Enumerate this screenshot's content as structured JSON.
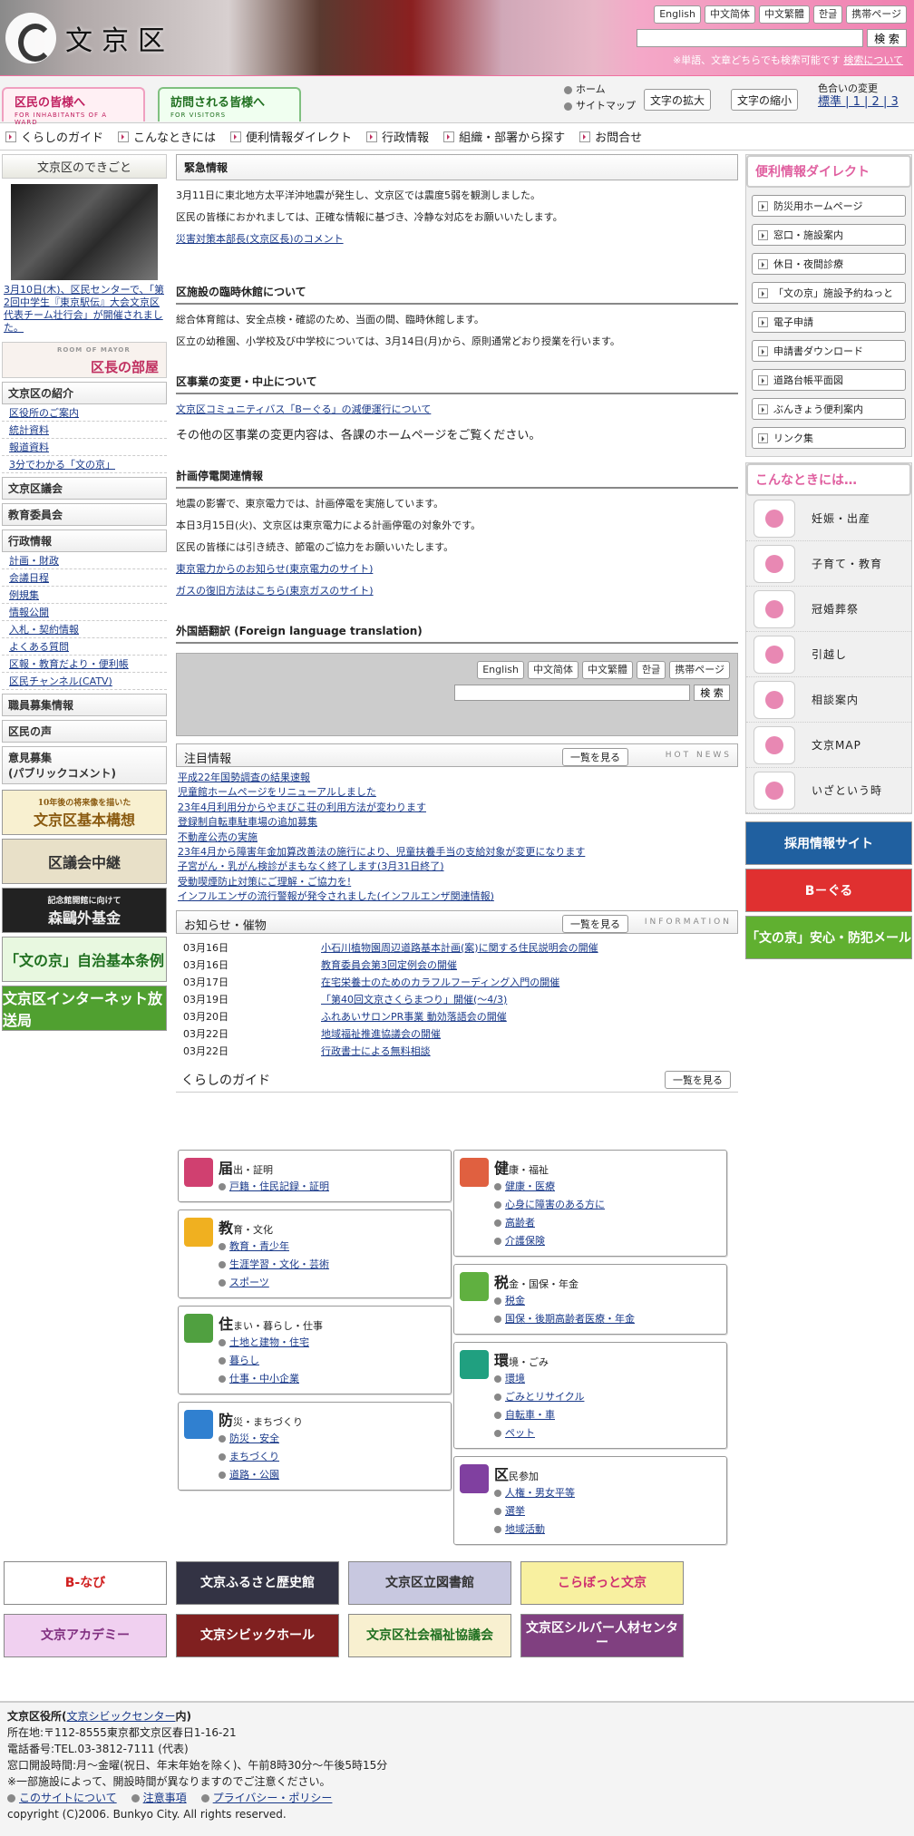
{
  "header": {
    "logo_text": "文京区",
    "lang": [
      "English",
      "中文简体",
      "中文繁體",
      "한글",
      "携帯ページ"
    ],
    "search_button": "検 索",
    "search_note": "※単語、文章どちらでも検索可能です",
    "search_help": "検索について"
  },
  "nav": {
    "tab_residents": "区民の皆様へ",
    "tab_residents_en": "FOR INHABITANTS OF A WARD",
    "tab_visitors": "訪問される皆様へ",
    "tab_visitors_en": "FOR VISITORS",
    "home": "ホーム",
    "sitemap": "サイトマップ",
    "font_bigger": "文字の拡大",
    "font_smaller": "文字の縮小",
    "color_change": "色合いの変更",
    "color_options": "標準 | 1 | 2 | 3"
  },
  "subnav": [
    "くらしのガイド",
    "こんなときには",
    "便利情報ダイレクト",
    "行政情報",
    "組織・部署から探す",
    "お問合せ"
  ],
  "left": {
    "dekigoto": "文京区のできごと",
    "caption": "3月10日(木)、区民センターで、「第2回中学生『東京駅伝』大会文京区代表チーム壮行会」が開催されました。",
    "mayor_small": "ROOM OF MAYOR",
    "mayor": "区長の部屋",
    "intro": "文京区の紹介",
    "intro_items": [
      "区役所のご案内",
      "統計資料",
      "報道資料",
      "3分でわかる「文の京」"
    ],
    "council": "文京区議会",
    "edu": "教育委員会",
    "gyosei": "行政情報",
    "gyosei_items": [
      "計画・財政",
      "会議日程",
      "例規集",
      "情報公開",
      "入札・契約情報",
      "よくある質問",
      "区報・教育だより・便利帳",
      "区民チャンネル(CATV)"
    ],
    "recruit": "職員募集情報",
    "voice": "区民の声",
    "opinion": "意見募集",
    "opinion_sub": "(パブリックコメント)",
    "banners": [
      "文京区基本構想",
      "区議会中継",
      "森鷗外基金",
      "「文の京」自治基本条例",
      "文京区インターネット放送局"
    ],
    "banner_sub": [
      "10年後の将来像を描いた",
      "",
      "記念館開館に向けて",
      "",
      ""
    ]
  },
  "main": {
    "emergency_title": "緊急情報",
    "em_p1": "3月11日に東北地方太平洋沖地震が発生し、文京区では震度5弱を観測しました。",
    "em_p2": "区民の皆様におかれましては、正確な情報に基づき、冷静な対応をお願いいたします。",
    "em_link": "災害対策本部長(文京区長)のコメント",
    "s2_title": "区施設の臨時休館について",
    "s2_p1": "総合体育館は、安全点検・確認のため、当面の間、臨時休館します。",
    "s2_p2": "区立の幼稚園、小学校及び中学校については、3月14日(月)から、原則通常どおり授業を行います。",
    "s3_title": "区事業の変更・中止について",
    "s3_link": "文京区コミュニティバス「Bーぐる」の減便運行について",
    "s3_p": "その他の区事業の変更内容は、各課のホームページをご覧ください。",
    "s4_title": "計画停電関連情報",
    "s4_p1": "地震の影響で、東京電力では、計画停電を実施しています。",
    "s4_p2": "本日3月15日(火)、文京区は東京電力による計画停電の対象外です。",
    "s4_p3": "区民の皆様には引き続き、節電のご協力をお願いいたします。",
    "s4_l1": "東京電力からのお知らせ(東京電力のサイト)",
    "s4_l2": "ガスの復旧方法はこちら(東京ガスのサイト)",
    "s5_title": "外国語翻訳 (Foreign language translation)",
    "hot_title": "注目情報",
    "more": "一覧を見る",
    "hot_en": "HOT NEWS",
    "hot": [
      "平成22年国勢調査の結果速報",
      "児童館ホームページをリニューアルしました",
      "23年4月利用分からやまびこ荘の利用方法が変わります",
      "登録制自転車駐車場の追加募集",
      "不動産公売の実施",
      "23年4月から障害年金加算改善法の施行により、児童扶養手当の支給対象が変更になります",
      "子宮がん・乳がん検診がまもなく終了します(3月31日終了)",
      "受動喫煙防止対策にご理解・ご協力を!",
      "インフルエンザの流行警報が発令されました(インフルエンザ関連情報)"
    ],
    "info_title": "お知らせ・催物",
    "info_en": "INFORMATION",
    "info": [
      {
        "d": "03月16日",
        "t": "小石川植物園周辺道路基本計画(案)に関する住民説明会の開催"
      },
      {
        "d": "03月16日",
        "t": "教育委員会第3回定例会の開催"
      },
      {
        "d": "03月17日",
        "t": "在宅栄養士のためのカラフルフーディング入門の開催"
      },
      {
        "d": "03月19日",
        "t": "「第40回文京さくらまつり」開催(～4/3)"
      },
      {
        "d": "03月20日",
        "t": "ふれあいサロンPR事業 動効落語会の開催"
      },
      {
        "d": "03月22日",
        "t": "地域福祉推進協議会の開催"
      },
      {
        "d": "03月22日",
        "t": "行政書士による無料相談"
      }
    ],
    "guide_title": "くらしのガイド",
    "guide_left": [
      {
        "h": "届",
        "s": "出・証明",
        "c": "#d04070",
        "items": [
          "戸籍・住民記録・証明"
        ]
      },
      {
        "h": "教",
        "s": "育・文化",
        "c": "#f0b020",
        "items": [
          "教育・青少年",
          "生涯学習・文化・芸術",
          "スポーツ"
        ]
      },
      {
        "h": "住",
        "s": "まい・暮らし・仕事",
        "c": "#50a040",
        "items": [
          "土地と建物・住宅",
          "暮らし",
          "仕事・中小企業"
        ]
      },
      {
        "h": "防",
        "s": "災・まちづくり",
        "c": "#3080d0",
        "items": [
          "防災・安全",
          "まちづくり",
          "道路・公園"
        ]
      }
    ],
    "guide_right": [
      {
        "h": "健",
        "s": "康・福祉",
        "c": "#e06040",
        "items": [
          "健康・医療",
          "心身に障害のある方に",
          "高齢者",
          "介護保険"
        ]
      },
      {
        "h": "税",
        "s": "金・国保・年金",
        "c": "#60b040",
        "items": [
          "税金",
          "国保・後期高齢者医療・年金"
        ]
      },
      {
        "h": "環",
        "s": "境・ごみ",
        "c": "#20a080",
        "items": [
          "環境",
          "ごみとリサイクル",
          "自転車・車",
          "ペット"
        ]
      },
      {
        "h": "区",
        "s": "民参加",
        "c": "#8040a0",
        "items": [
          "人権・男女平等",
          "選挙",
          "地域活動"
        ]
      }
    ]
  },
  "right": {
    "direct": "便利情報ダイレクト",
    "direct_items": [
      "防災用ホームページ",
      "窓口・施設案内",
      "休日・夜間診療",
      "「文の京」施設予約ねっと",
      "電子申請",
      "申請書ダウンロード",
      "道路台帳平面図",
      "ぶんきょう便利案内",
      "リンク集"
    ],
    "konna": "こんなときには…",
    "konna_items": [
      "妊娠・出産",
      "子育て・教育",
      "冠婚葬祭",
      "引越し",
      "相談案内",
      "文京MAP",
      "いざという時"
    ],
    "banners": [
      "採用情報サイト",
      "B－ぐる",
      "「文の京」安心・防犯メール"
    ]
  },
  "bottom": [
    "B-なび",
    "文京ふるさと歴史館",
    "文京区立図書館",
    "こらぼっと文京",
    "文京アカデミー",
    "文京シビックホール",
    "文京区社会福祉協議会",
    "文京区シルバー人材センター"
  ],
  "footer": {
    "office": "文京区役所(",
    "office_link": "文京シビックセンター",
    "office_end": "内)",
    "address": "所在地:〒112-8555東京都文京区春日1-16-21",
    "tel": "電話番号:TEL.03-3812-7111 (代表)",
    "hours": "窓口開設時間:月～金曜(祝日、年末年始を除く)、午前8時30分～午後5時15分",
    "note": "※一部施設によって、開設時間が異なりますのでご注意ください。",
    "links": [
      "このサイトについて",
      "注意事項",
      "プライバシー・ポリシー"
    ],
    "copyright": "copyright (C)2006. Bunkyo City. All rights reserved."
  }
}
